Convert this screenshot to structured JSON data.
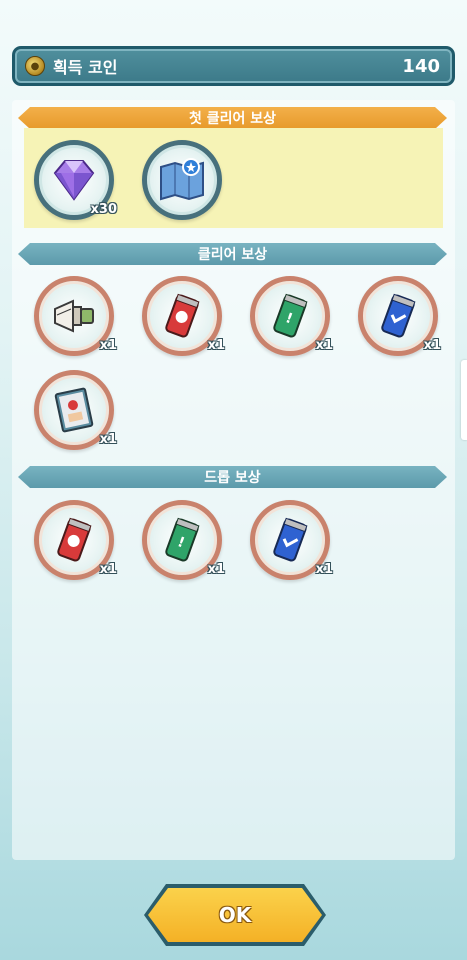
{
  "header": {
    "coin_label": "획득 코인",
    "coin_value": "140"
  },
  "sections": {
    "first_clear": {
      "title": "첫 클리어 보상"
    },
    "clear": {
      "title": "클리어 보상"
    },
    "drop": {
      "title": "드롭 보상"
    }
  },
  "first_clear_items": [
    {
      "icon": "diamond-icon",
      "qty": "x30"
    },
    {
      "icon": "map-icon",
      "qty": ""
    }
  ],
  "clear_items": [
    {
      "icon": "megaphone-icon",
      "qty": "x1"
    },
    {
      "icon": "red-can-icon",
      "qty": "x1"
    },
    {
      "icon": "green-can-icon",
      "qty": "x1"
    },
    {
      "icon": "blue-can-icon",
      "qty": "x1"
    },
    {
      "icon": "book-icon",
      "qty": "x1"
    }
  ],
  "drop_items": [
    {
      "icon": "red-can-icon",
      "qty": "x1"
    },
    {
      "icon": "green-can-icon",
      "qty": "x1"
    },
    {
      "icon": "blue-can-icon",
      "qty": "x1"
    }
  ],
  "buttons": {
    "ok_label": "OK"
  },
  "colors": {
    "orange_bar": "#e79a2a",
    "teal_bar": "#5c9aab",
    "first_box": "#f6f3b6",
    "ok_button": "#f4b126"
  }
}
